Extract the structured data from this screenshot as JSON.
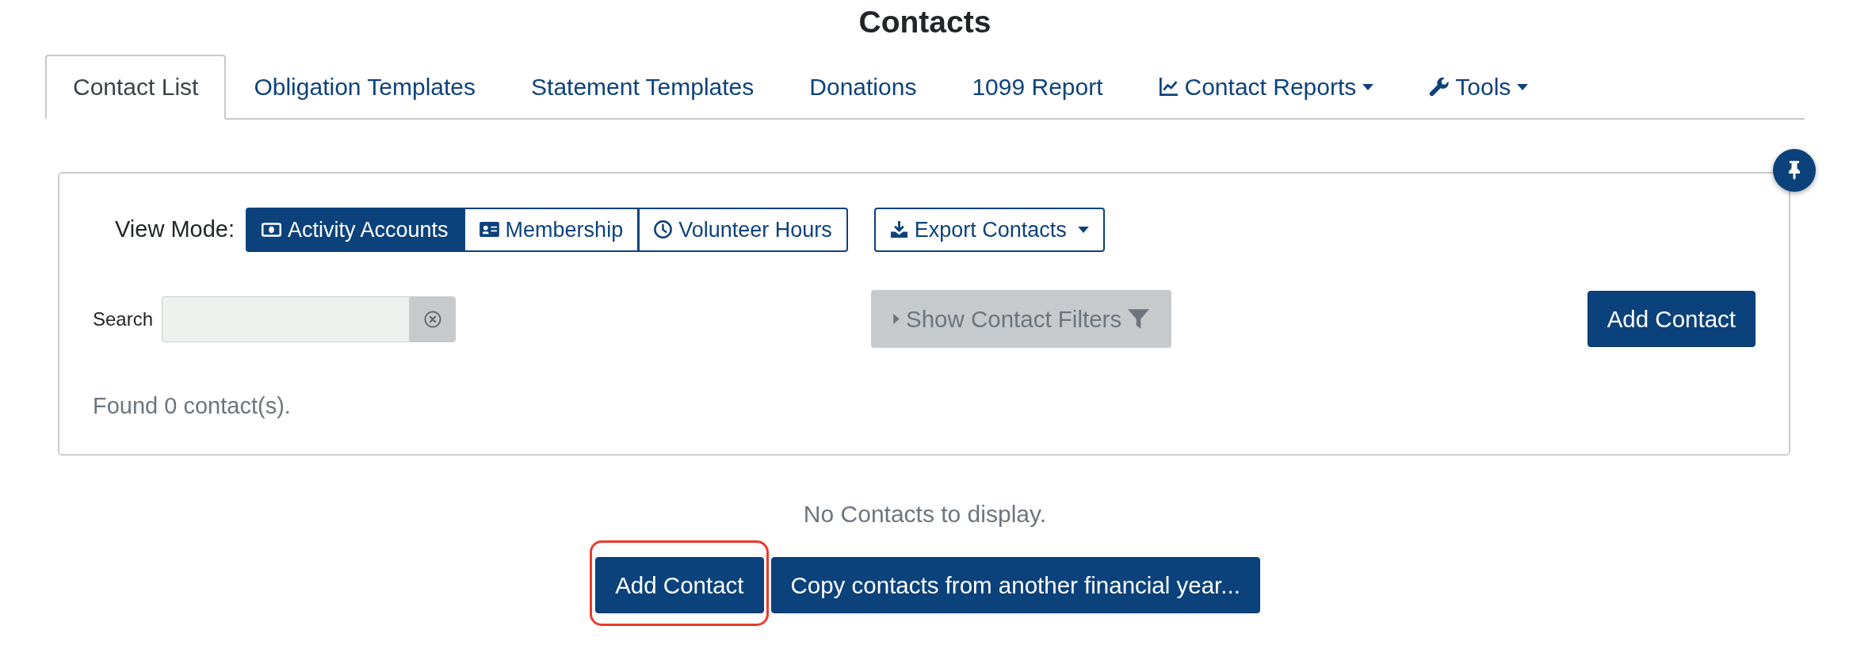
{
  "title": "Contacts",
  "tabs": [
    {
      "label": "Contact List",
      "selected": true,
      "kind": "link"
    },
    {
      "label": "Obligation Templates",
      "selected": false,
      "kind": "link"
    },
    {
      "label": "Statement Templates",
      "selected": false,
      "kind": "link"
    },
    {
      "label": "Donations",
      "selected": false,
      "kind": "link"
    },
    {
      "label": "1099 Report",
      "selected": false,
      "kind": "link"
    },
    {
      "label": "Contact Reports",
      "selected": false,
      "kind": "report_menu"
    },
    {
      "label": "Tools",
      "selected": false,
      "kind": "tools_menu"
    }
  ],
  "view_mode": {
    "label": "View Mode:",
    "options": [
      {
        "label": "Activity Accounts",
        "selected": true,
        "kind": "accounts"
      },
      {
        "label": "Membership",
        "selected": false,
        "kind": "membership"
      },
      {
        "label": "Volunteer Hours",
        "selected": false,
        "kind": "hours"
      }
    ]
  },
  "export_button": {
    "label": "Export Contacts"
  },
  "search": {
    "label": "Search"
  },
  "filters_button": {
    "label": "Show Contact Filters",
    "disabled": true
  },
  "add_button": {
    "label": "Add Contact"
  },
  "result_count": "Found 0 contact(s).",
  "empty_message": "No Contacts to display.",
  "bottom_buttons": [
    {
      "label": "Add Contact",
      "highlighted": true
    },
    {
      "label": "Copy contacts from another financial year...",
      "highlighted": false
    }
  ]
}
